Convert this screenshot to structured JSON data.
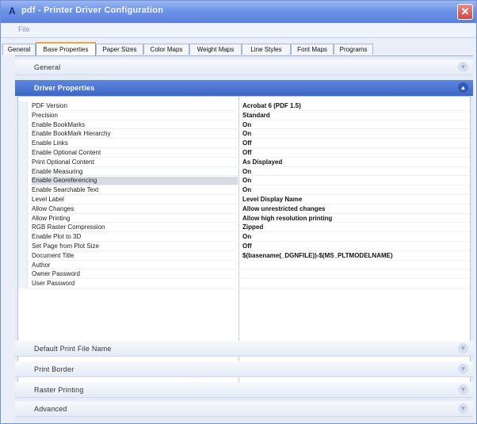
{
  "window": {
    "title": "pdf - Printer Driver Configuration",
    "close_glyph": "✕"
  },
  "menubar": {
    "file_label": "File"
  },
  "tabs": [
    {
      "label": "General"
    },
    {
      "label": "Base Properties",
      "active": true
    },
    {
      "label": "Paper Sizes"
    },
    {
      "label": "Color Maps"
    },
    {
      "label": "Weight Maps"
    },
    {
      "label": "Line Styles"
    },
    {
      "label": "Font Maps"
    },
    {
      "label": "Programs"
    }
  ],
  "groups": {
    "general": {
      "label": "General"
    },
    "driver_properties": {
      "label": "Driver Properties"
    },
    "default_print_file_name": {
      "label": "Default Print File Name"
    },
    "print_border": {
      "label": "Print Border"
    },
    "raster_printing": {
      "label": "Raster Printing"
    },
    "advanced": {
      "label": "Advanced"
    }
  },
  "icons": {
    "chevron_collapsed": "▼",
    "chevron_expanded": "▲",
    "app": "A"
  },
  "properties": [
    {
      "name": "PDF Version",
      "value": "Acrobat 6 (PDF 1.5)"
    },
    {
      "name": "Precision",
      "value": "Standard"
    },
    {
      "name": "Enable BookMarks",
      "value": "On"
    },
    {
      "name": "Enable BookMark Hierarchy",
      "value": "On"
    },
    {
      "name": "Enable Links",
      "value": "Off"
    },
    {
      "name": "Enable Optional Content",
      "value": "Off"
    },
    {
      "name": "Print Optional Content",
      "value": "As Displayed"
    },
    {
      "name": "Enable Measuring",
      "value": "On"
    },
    {
      "name": "Enable Georeferencing",
      "value": "On",
      "selected": true
    },
    {
      "name": "Enable Searchable Text",
      "value": "On"
    },
    {
      "name": "Level Label",
      "value": "Level Display Name"
    },
    {
      "name": "Allow Changes",
      "value": "Allow unrestricted changes"
    },
    {
      "name": "Allow Printing",
      "value": "Allow high resolution printing"
    },
    {
      "name": "RGB Raster Compression",
      "value": "Zipped"
    },
    {
      "name": "Enable Plot to 3D",
      "value": "On"
    },
    {
      "name": "Set Page from Plot Size",
      "value": "Off"
    },
    {
      "name": "Document Title",
      "value": "$(basename(_DGNFILE))-$(MS_PLTMODELNAME)"
    },
    {
      "name": "Author",
      "value": ""
    },
    {
      "name": "Owner Password",
      "value": ""
    },
    {
      "name": "User Password",
      "value": ""
    }
  ],
  "colors": {
    "titlebar": "#6e93e8",
    "expanded_header": "#3d67c7",
    "active_tab_accent": "#f1a63a"
  }
}
